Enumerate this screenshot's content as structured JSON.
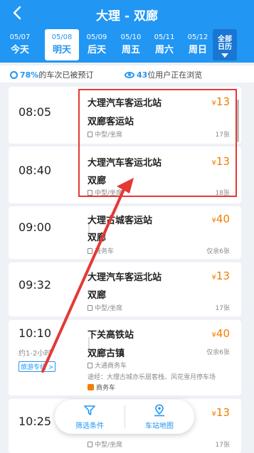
{
  "header": {
    "title": "大理 - 双廊"
  },
  "dates": [
    {
      "date": "05/07",
      "weekday": "今天"
    },
    {
      "date": "05/08",
      "weekday": "明天"
    },
    {
      "date": "05/09",
      "weekday": "后天"
    },
    {
      "date": "05/10",
      "weekday": "周五"
    },
    {
      "date": "05/11",
      "weekday": "周六"
    },
    {
      "date": "05/12",
      "weekday": "周日"
    }
  ],
  "all_calendar": {
    "line1": "全部",
    "line2": "日历"
  },
  "stats": {
    "booked_pct": "78%",
    "booked_text": "的车次已被预订",
    "viewers": "43",
    "viewers_text": "位用户正在浏览"
  },
  "trips": [
    {
      "time": "08:05",
      "from": "大理汽车客运北站",
      "to": "双廊客运站",
      "price": "13",
      "bus": "中型/坐席",
      "left": "17张"
    },
    {
      "time": "08:40",
      "from": "大理汽车客运北站",
      "to": "双廊",
      "price": "13",
      "bus": "中型/坐席",
      "left": "18张"
    },
    {
      "time": "09:00",
      "from": "大理古城客运站",
      "to": "双廊",
      "price": "40",
      "bus": "商务车",
      "left": "仅余6张"
    },
    {
      "time": "09:32",
      "from": "大理汽车客运北站",
      "to": "双廊",
      "price": "13",
      "bus": "中型/坐席",
      "left": "17张"
    },
    {
      "time": "10:10",
      "sub": "约1-2小时",
      "badge": "旅游专线 >",
      "from": "下关高铁站",
      "to": "双廊古镇",
      "price": "40",
      "bus": "大通商务车",
      "left": "仅余6张",
      "via": "途经：大理古城亦乐居客栈、风花雪月停车场",
      "tag": "商务车"
    },
    {
      "time": "10:25",
      "from": "",
      "to": "",
      "price": "13",
      "bus": "中型/坐席",
      "left": "17张"
    }
  ],
  "currency": "¥",
  "fab": {
    "filter": "筛选条件",
    "map": "车站地图"
  }
}
